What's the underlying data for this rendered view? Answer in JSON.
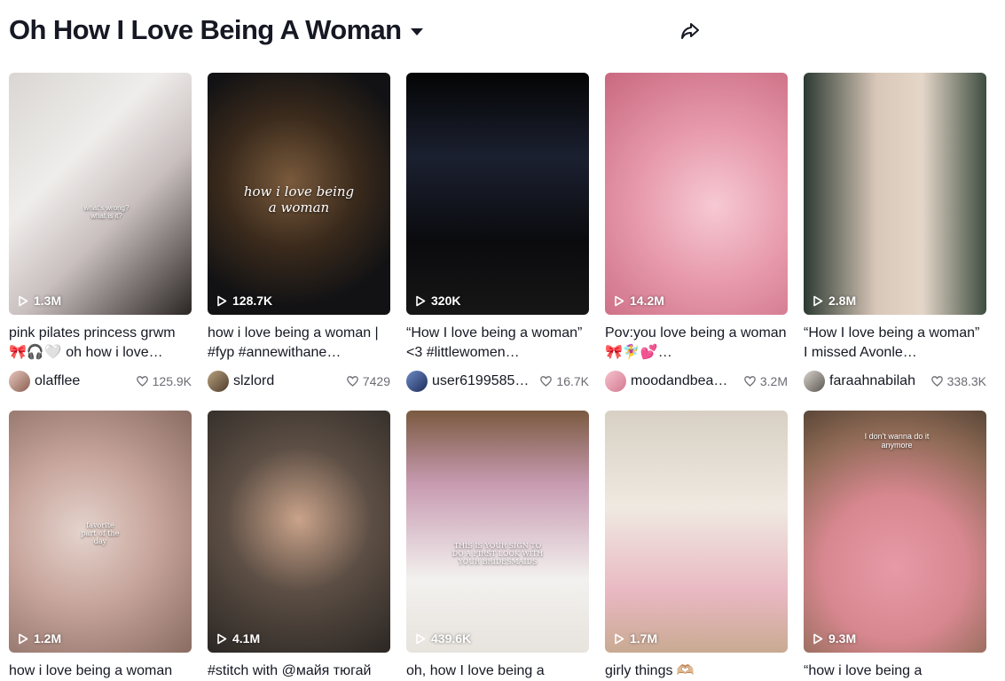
{
  "header": {
    "title": "Oh How I Love Being A Woman",
    "icons": {
      "dropdown": "caret-down-icon",
      "share": "share-arrow-icon"
    }
  },
  "colors": {
    "text": "#161823",
    "muted": "#6b6b73",
    "background": "#ffffff"
  },
  "videos": [
    {
      "views": "1.3M",
      "overlay": "what's wrong? what is it?",
      "caption": "pink pilates princess grwm 🎀🎧🤍 oh how i love…",
      "username": "olafflee",
      "likes": "125.9K"
    },
    {
      "views": "128.7K",
      "overlay": "how i love being a woman",
      "caption": "how i love being a woman | #fyp #annewithane…",
      "username": "slzlord",
      "likes": "7429"
    },
    {
      "views": "320K",
      "overlay": "",
      "caption": "“How I love being a woman” <3 #littlewomen…",
      "username": "user6199585…",
      "likes": "16.7K"
    },
    {
      "views": "14.2M",
      "overlay": "",
      "caption": "Pov:you love being a woman 🎀🧚‍♀️💕…",
      "username": "moodandbea…",
      "likes": "3.2M"
    },
    {
      "views": "2.8M",
      "overlay": "",
      "caption": "“How I love being a woman” I missed Avonle…",
      "username": "faraahnabilah",
      "likes": "338.3K"
    },
    {
      "views": "1.2M",
      "overlay": "favorite part of the day",
      "caption": "how i love being a woman",
      "username": "",
      "likes": ""
    },
    {
      "views": "4.1M",
      "overlay": "",
      "caption": "#stitch with @майя тюгай",
      "username": "",
      "likes": ""
    },
    {
      "views": "439.6K",
      "overlay": "THIS IS YOUR SIGN TO DO A FIRST LOOK WITH YOUR BRIDESMAIDS",
      "caption": "oh, how I love being a",
      "username": "",
      "likes": ""
    },
    {
      "views": "1.7M",
      "overlay": "",
      "caption": "girly things 🫶🏼",
      "username": "",
      "likes": ""
    },
    {
      "views": "9.3M",
      "overlay": "I don't wanna do it anymore",
      "caption": "“how i love being a",
      "username": "",
      "likes": ""
    }
  ]
}
